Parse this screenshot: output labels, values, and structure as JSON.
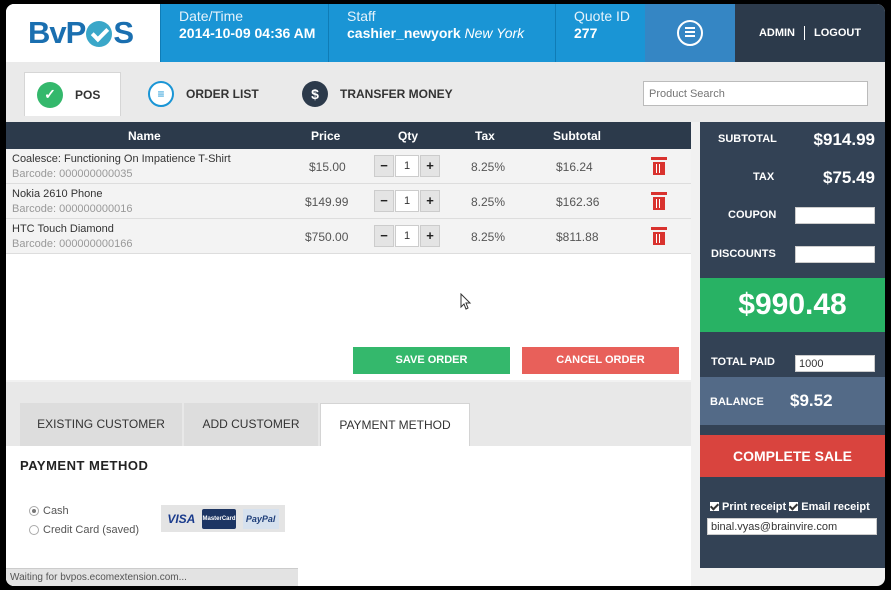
{
  "header": {
    "logo": "BvPOS",
    "datetime_label": "Date/Time",
    "datetime_value": "2014-10-09 04:36 AM",
    "staff_label": "Staff",
    "staff_name": "cashier_newyork",
    "staff_location": "New York",
    "quote_label": "Quote ID",
    "quote_value": "277",
    "calculator_icon": "calculator-icon",
    "admin": "ADMIN",
    "logout": "LOGOUT"
  },
  "tabs": {
    "pos": "POS",
    "order_list": "ORDER LIST",
    "transfer_money": "TRANSFER MONEY"
  },
  "search": {
    "placeholder": "Product Search"
  },
  "table": {
    "headers": {
      "name": "Name",
      "price": "Price",
      "qty": "Qty",
      "tax": "Tax",
      "subtotal": "Subtotal"
    },
    "rows": [
      {
        "name": "Coalesce: Functioning On Impatience T-Shirt",
        "barcode": "Barcode: 000000000035",
        "price": "$15.00",
        "qty": "1",
        "tax": "8.25%",
        "subtotal": "$16.24"
      },
      {
        "name": "Nokia 2610 Phone",
        "barcode": "Barcode: 000000000016",
        "price": "$149.99",
        "qty": "1",
        "tax": "8.25%",
        "subtotal": "$162.36"
      },
      {
        "name": "HTC Touch Diamond",
        "barcode": "Barcode: 000000000166",
        "price": "$750.00",
        "qty": "1",
        "tax": "8.25%",
        "subtotal": "$811.88"
      }
    ],
    "minus": "−",
    "plus": "+"
  },
  "actions": {
    "save_order": "SAVE ORDER",
    "cancel_order": "CANCEL ORDER"
  },
  "customer_tabs": {
    "existing": "EXISTING CUSTOMER",
    "add": "ADD CUSTOMER",
    "payment": "PAYMENT METHOD"
  },
  "payment": {
    "title": "PAYMENT METHOD",
    "cash": "Cash",
    "credit": "Credit Card (saved)",
    "cards": {
      "visa": "VISA",
      "mastercard": "MasterCard",
      "paypal": "PayPal"
    }
  },
  "status_bar": "Waiting for bvpos.ecomextension.com...",
  "summary": {
    "subtotal_label": "SUBTOTAL",
    "subtotal_value": "$914.99",
    "tax_label": "TAX",
    "tax_value": "$75.49",
    "coupon_label": "COUPON",
    "discounts_label": "DISCOUNTS",
    "total": "$990.48",
    "total_paid_label": "TOTAL PAID",
    "total_paid_value": "1000",
    "balance_label": "BALANCE",
    "balance_value": "$9.52",
    "complete_sale": "COMPLETE SALE",
    "print_receipt": "Print receipt",
    "email_receipt": "Email receipt",
    "email_value": "binal.vyas@brainvire.com"
  },
  "colors": {
    "header_blue": "#1a95d5",
    "dark_navy": "#2c3a4b",
    "green": "#34b86c",
    "red": "#e8605a"
  }
}
